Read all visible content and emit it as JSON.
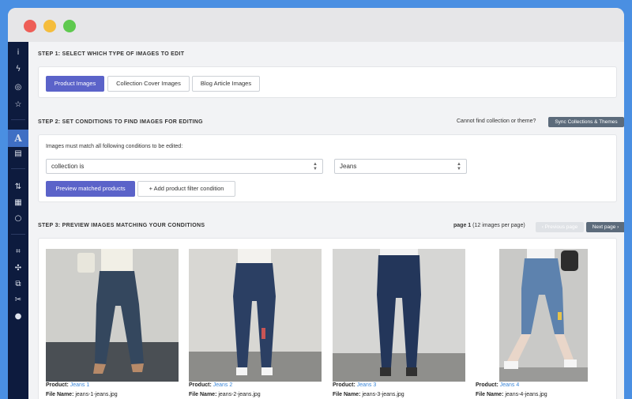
{
  "window": {
    "controls": [
      "close",
      "minimize",
      "maximize"
    ]
  },
  "sidebar": {
    "icons": [
      {
        "name": "info-icon",
        "glyph": "i"
      },
      {
        "name": "bolt-icon",
        "glyph": "ϟ"
      },
      {
        "name": "target-icon",
        "glyph": "◎"
      },
      {
        "name": "star-icon",
        "glyph": "☆"
      },
      {
        "name": "font-icon",
        "glyph": "A",
        "active": true
      },
      {
        "name": "document-icon",
        "glyph": "▤"
      },
      {
        "name": "sort-icon",
        "glyph": "⇅"
      },
      {
        "name": "file-icon",
        "glyph": "▦"
      },
      {
        "name": "circle-icon",
        "glyph": "○"
      },
      {
        "name": "crop-icon",
        "glyph": "⌗"
      },
      {
        "name": "resize-icon",
        "glyph": "✣"
      },
      {
        "name": "images-icon",
        "glyph": "⧉"
      },
      {
        "name": "scissors-icon",
        "glyph": "✂"
      },
      {
        "name": "droplet-icon",
        "glyph": "●"
      }
    ]
  },
  "step1": {
    "title": "STEP 1: SELECT WHICH TYPE OF IMAGES TO EDIT",
    "buttons": [
      "Product Images",
      "Collection Cover Images",
      "Blog Article Images"
    ]
  },
  "step2": {
    "title": "STEP 2: SET CONDITIONS TO FIND IMAGES FOR EDITING",
    "cant_find": "Cannot find collection or theme?",
    "sync_button": "Sync Collections & Themes",
    "instruction": "Images must match all following conditions to be edited:",
    "condition_field": "collection is",
    "condition_value": "Jeans",
    "preview_button": "Preview matched products",
    "add_filter_button": "+ Add product filter condition"
  },
  "step3": {
    "title": "STEP 3: PREVIEW IMAGES MATCHING YOUR CONDITIONS",
    "page_label": "page 1",
    "page_info": "(12 images per page)",
    "prev_button": "‹ Previous page",
    "next_button": "Next page ›"
  },
  "products": [
    {
      "product_label": "Product:",
      "name": "Jeans 1",
      "file_label": "File Name:",
      "file": "jeans-1-jeans.jpg"
    },
    {
      "product_label": "Product:",
      "name": "Jeans 2",
      "file_label": "File Name:",
      "file": "jeans-2-jeans.jpg"
    },
    {
      "product_label": "Product:",
      "name": "Jeans 3",
      "file_label": "File Name:",
      "file": "jeans-3-jeans.jpg"
    },
    {
      "product_label": "Product:",
      "name": "Jeans 4",
      "file_label": "File Name:",
      "file": "jeans-4-jeans.jpg"
    }
  ],
  "colors": {
    "primary": "#5b63c9",
    "sidebar": "#0d1b3e",
    "link": "#3b86d8",
    "frame": "#4a8fe2"
  }
}
